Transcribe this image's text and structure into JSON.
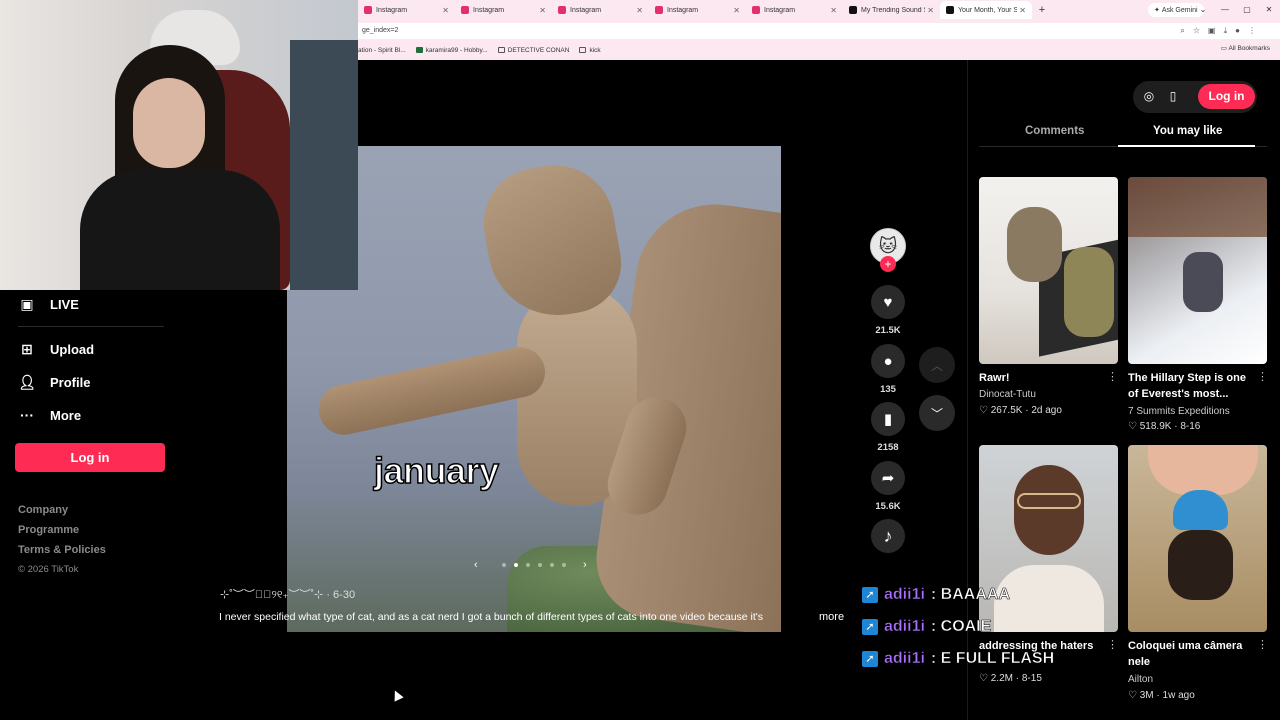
{
  "browser": {
    "tabs": [
      {
        "label": "Instagram",
        "color": "#e1306c"
      },
      {
        "label": "Instagram",
        "color": "#e1306c"
      },
      {
        "label": "Instagram",
        "color": "#e1306c"
      },
      {
        "label": "Instagram",
        "color": "#e1306c"
      },
      {
        "label": "Instagram",
        "color": "#e1306c"
      },
      {
        "label": "My Trending Sound Styl",
        "color": "#111111"
      },
      {
        "label": "Your Month, Your Silly C",
        "color": "#111111",
        "active": true
      }
    ],
    "ask_gemini": "Ask Gemini",
    "address": "ge_index=2",
    "bookmarks": [
      "ation - Spirit Bl...",
      "karamira99 - Hobby...",
      "DETECTIVE CONAN",
      "kick"
    ],
    "all_bookmarks": "All Bookmarks"
  },
  "sidebar": {
    "items": [
      {
        "label": "LIVE",
        "icon": "live-icon"
      },
      {
        "label": "Upload",
        "icon": "upload-icon"
      },
      {
        "label": "Profile",
        "icon": "profile-icon"
      },
      {
        "label": "More",
        "icon": "more-icon"
      }
    ],
    "login": "Log in",
    "footer": [
      "Company",
      "Programme",
      "Terms & Policies"
    ],
    "copyright": "© 2026 TikTok"
  },
  "video": {
    "caption_overlay": "january",
    "author_line": "⊹˚︶︶₊ﾟ୨୧₊︶︶˚⊹ · 6-30",
    "description": "I never specified what type of cat, and as a cat nerd I got a bunch of different types of cats into one video because it's",
    "more": "more",
    "carousel": {
      "total": 6,
      "current": 2
    }
  },
  "actions": {
    "likes": "21.5K",
    "comments": "135",
    "saves": "2158",
    "shares": "15.6K"
  },
  "chat": [
    {
      "user": "adii1i",
      "message": ": BAAAAA"
    },
    {
      "user": "adii1i",
      "message": ": COAIE"
    },
    {
      "user": "adii1i",
      "message": ": E FULL FLASH"
    }
  ],
  "right_panel": {
    "login": "Log in",
    "tabs": [
      "Comments",
      "You may like"
    ],
    "active_tab": "You may like",
    "cards": [
      {
        "title": "Rawr!",
        "author": "Dinocat-Tutu",
        "likes": "267.5K",
        "date": "2d ago"
      },
      {
        "title": "The Hillary Step is one of Everest's most...",
        "author": "7 Summits Expeditions",
        "likes": "518.9K",
        "date": "8-16"
      },
      {
        "title": "addressing the haters",
        "author": "",
        "likes": "2.2M",
        "date": "8-15"
      },
      {
        "title": "Coloquei uma câmera nele",
        "author": "Ailton",
        "likes": "3M",
        "date": "1w ago"
      }
    ]
  },
  "colors": {
    "brand": "#fe2c55",
    "chat_user": "#a970ff",
    "chat_icon": "#1e86d6"
  }
}
